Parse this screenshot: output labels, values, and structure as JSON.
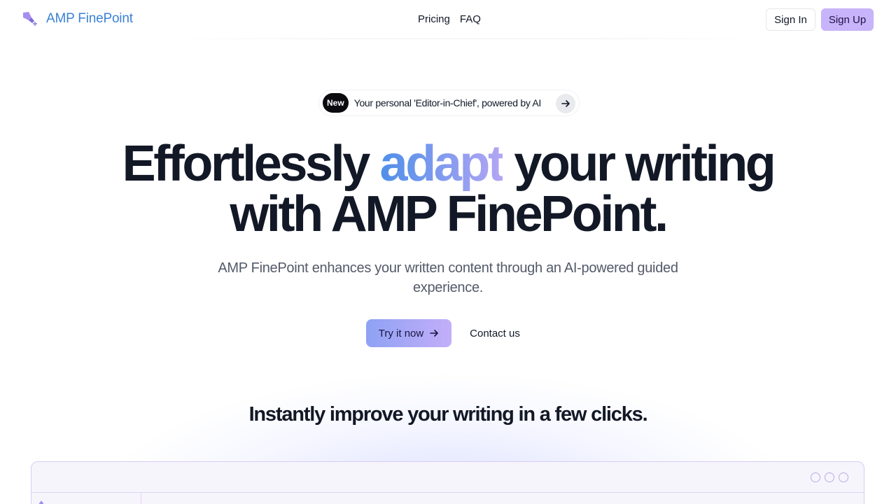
{
  "brand": {
    "name": "AMP FinePoint",
    "logo_icon": "pen-nib-icon",
    "accent_color": "#3b82d6"
  },
  "nav": {
    "items": [
      {
        "label": "Pricing"
      },
      {
        "label": "FAQ"
      }
    ]
  },
  "auth": {
    "sign_in": "Sign In",
    "sign_up": "Sign Up"
  },
  "announcement": {
    "badge": "New",
    "text": "Your personal 'Editor-in-Chief', powered by AI",
    "arrow_icon": "arrow-right-icon"
  },
  "hero": {
    "title_part1": "Effortlessly",
    "title_accent": "adapt",
    "title_part2": "your writing",
    "title_line2": "with AMP FinePoint.",
    "subtitle": "AMP FinePoint enhances your written content through an AI-powered guided experience.",
    "cta_primary": "Try it now",
    "cta_secondary": "Contact us"
  },
  "section": {
    "title": "Instantly improve your writing in a few clicks."
  },
  "colors": {
    "signup_bg": "#c8b4fb",
    "cta_gradient_start": "#8ea2f4",
    "cta_gradient_end": "#c3aef9",
    "title_accent_start": "#4f8fe9",
    "title_accent_end": "#b3a6f4"
  }
}
